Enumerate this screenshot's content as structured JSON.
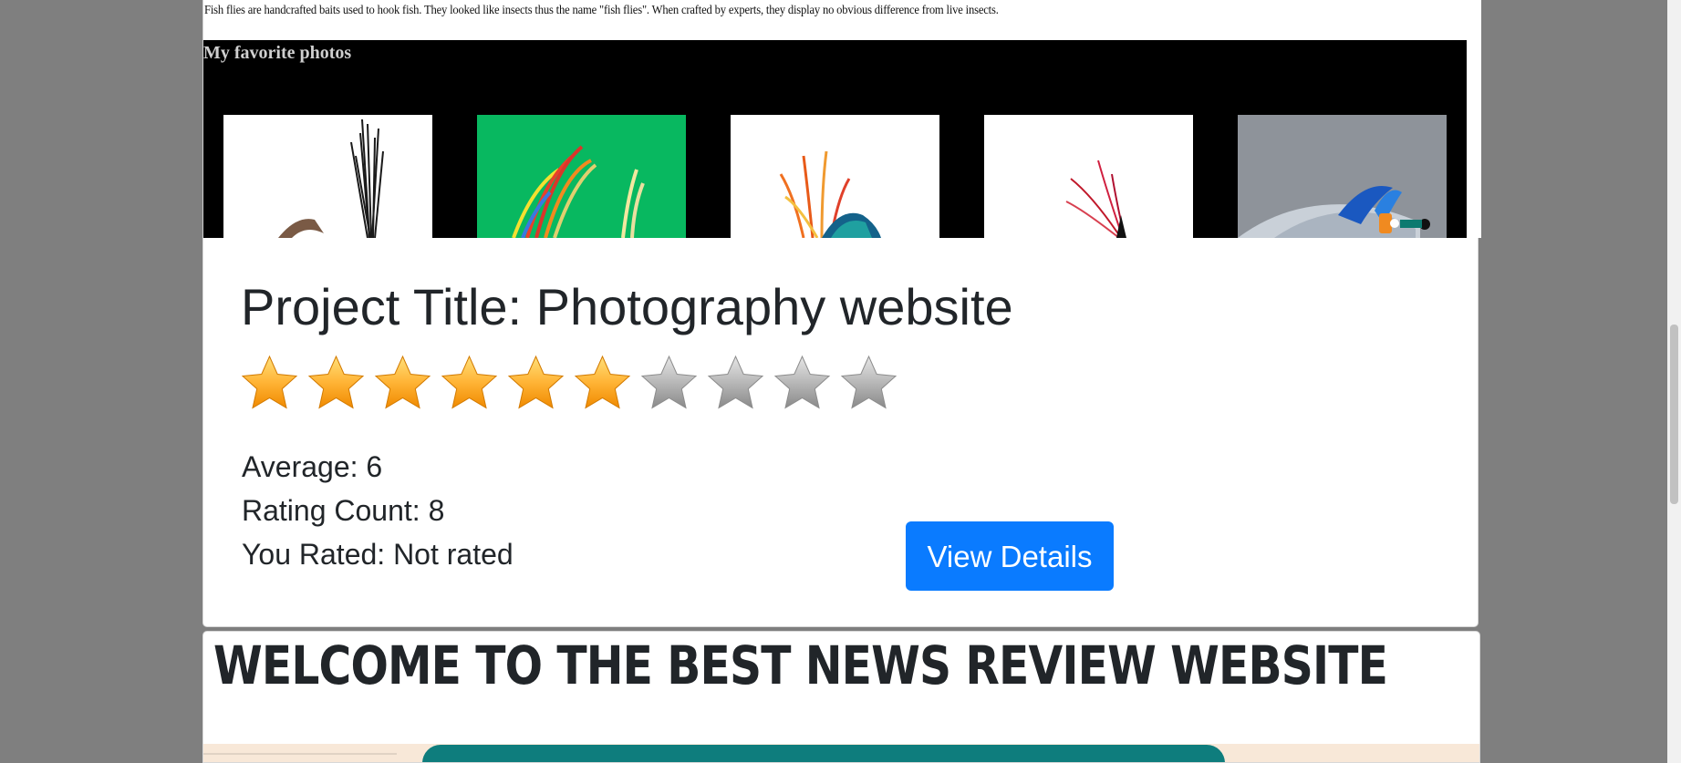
{
  "iframe": {
    "intro_text": "Fish flies are handcrafted baits used to hook fish. They looked like insects thus the name \"fish flies\". When crafted by experts, they display no obvious difference from live insects.",
    "gallery_title": "My favorite photos",
    "photos": [
      {
        "name": "fly-photo-1",
        "bg": "#ffffff"
      },
      {
        "name": "fly-photo-2",
        "bg": "#08b860"
      },
      {
        "name": "fly-photo-3",
        "bg": "#ffffff"
      },
      {
        "name": "fly-photo-4",
        "bg": "#ffffff"
      },
      {
        "name": "fly-photo-5",
        "bg": "#8e939a"
      }
    ]
  },
  "project": {
    "title": "Project Title: Photography website",
    "rating_filled": 6,
    "rating_max": 10,
    "average": "Average: 6",
    "rating_count": "Rating Count: 8",
    "you_rated": "You Rated: Not rated",
    "view_details_label": "View Details",
    "accent_color": "#0a7bff"
  },
  "welcome": {
    "title": "WELCOME TO THE BEST NEWS REVIEW WEBSITE"
  }
}
